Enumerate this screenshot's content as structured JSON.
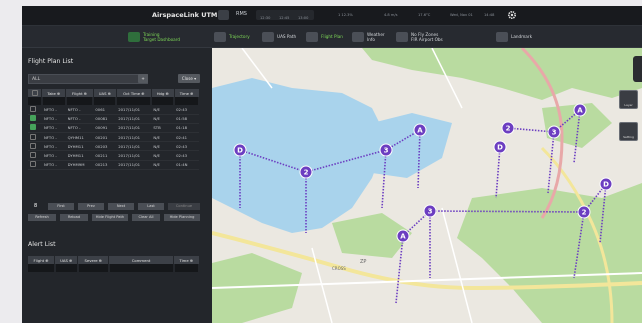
{
  "app": {
    "name": "AirspaceLink UTM",
    "status": [
      "RMS",
      "12:30",
      "12:45",
      "13:00"
    ],
    "stats": [
      "1 12.3%",
      "4.8 m/s",
      "17.6°C",
      "Wed, Nov 01",
      "14:48"
    ]
  },
  "toolbar": {
    "training_label": "Training",
    "target_label": "Target",
    "dashboard_label": "Dashboard",
    "trajectory_label": "Trajectory",
    "uas_path_label": "UAS Path",
    "flight_plan_label": "Flight Plan",
    "weather_label": "Weather",
    "info_label": "Info",
    "nfz_label": "No Fly Zones",
    "nfz_sub": "FIR",
    "airport_label": "Airport",
    "obs_label": "Obs",
    "landmark_label": "Landmark"
  },
  "flight_plan_list": {
    "title": "Flight Plan List",
    "filter_value": "ALL",
    "filter_button": "+",
    "close_button": "Close ▾",
    "columns": [
      "Take ⊕",
      "Flight ⊕",
      "UAS ⊕",
      "Oct Time ⊕",
      "Hdg ⊕",
      "Time ⊕"
    ],
    "rows": [
      {
        "checked": false,
        "cells": [
          "NFTO -",
          "NFTO -",
          "0061",
          "2017/11/01",
          "N/E",
          "02:43"
        ]
      },
      {
        "checked": true,
        "cells": [
          "NFTO -",
          "NFTO -",
          "00081",
          "2017/11/01",
          "N/E",
          "01:58"
        ]
      },
      {
        "checked": true,
        "cells": [
          "NFTO -",
          "NFTO -",
          "00091",
          "2017/11/01",
          "STB",
          "01:18"
        ]
      },
      {
        "checked": false,
        "cells": [
          "NFTO -",
          "QYHM11",
          "00201",
          "2017/11/01",
          "N/E",
          "02:41"
        ]
      },
      {
        "checked": false,
        "cells": [
          "NFTO -",
          "DYHM11",
          "00203",
          "2017/11/01",
          "N/E",
          "02:43"
        ]
      },
      {
        "checked": false,
        "cells": [
          "NFTO -",
          "DYHM11",
          "00211",
          "2017/11/01",
          "N/E",
          "02:43"
        ]
      },
      {
        "checked": false,
        "cells": [
          "NFTO -",
          "DYHM9M",
          "00213",
          "2017/11/01",
          "N/E",
          "01:4N"
        ]
      }
    ],
    "page_number": "8",
    "page_buttons": [
      "First",
      "Prev",
      "Next",
      "Last",
      "Continue"
    ],
    "action_buttons": [
      "Refresh",
      "Reload",
      "Hide Flight Path",
      "Clear All",
      "Hide Planning"
    ]
  },
  "alert_list": {
    "title": "Alert List",
    "columns": [
      "Flight ⊕",
      "UAS ⊕",
      "Severe ⊕",
      "Comment",
      "Time ⊕"
    ]
  },
  "map": {
    "labels": [
      "3",
      "2",
      "D",
      "A"
    ],
    "waypoint_color": "#6c3ec1",
    "route_color": "#6c3ec1",
    "road_color": "#f3e69a",
    "highway_color": "#e8a8a8",
    "water_color": "#a9d3ec",
    "park_color": "#b9dba0",
    "place_labels": [
      "ZP",
      "CROSS"
    ],
    "controls": [
      "Layer",
      "Setting"
    ]
  }
}
